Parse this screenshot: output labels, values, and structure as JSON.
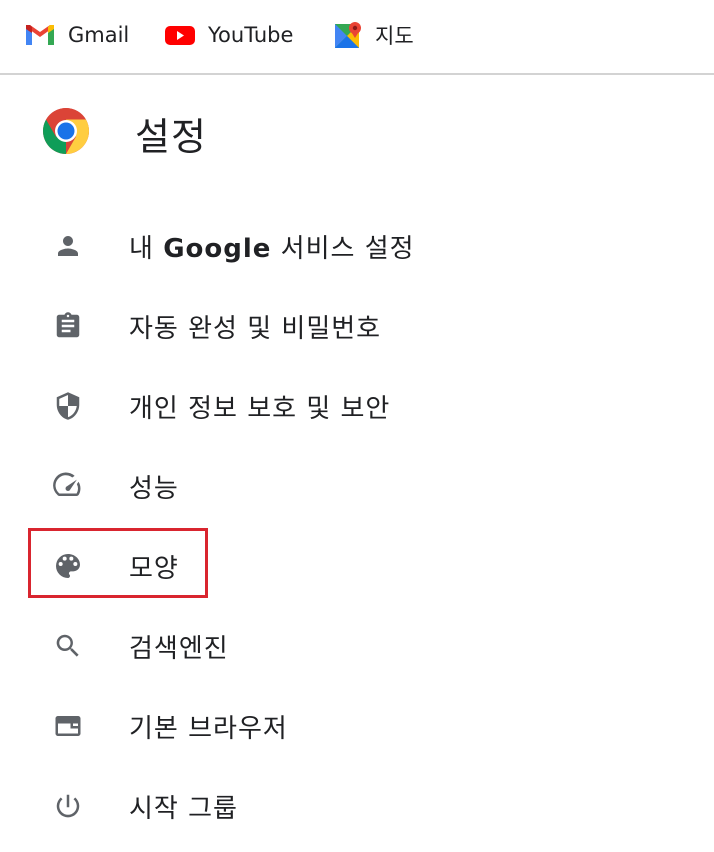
{
  "bookmarks": [
    {
      "label": "Gmail",
      "icon": "gmail-icon"
    },
    {
      "label": "YouTube",
      "icon": "youtube-icon"
    },
    {
      "label": "지도",
      "icon": "google-maps-icon"
    }
  ],
  "header": {
    "title": "설정",
    "logo_icon": "chrome-logo-icon"
  },
  "menu": {
    "items": [
      {
        "icon": "person-icon",
        "label_prefix": "내 ",
        "label_bold": "Google",
        "label_suffix": " 서비스 설정"
      },
      {
        "icon": "clipboard-icon",
        "label": "자동 완성 및 비밀번호"
      },
      {
        "icon": "shield-icon",
        "label": "개인 정보 보호 및 보안"
      },
      {
        "icon": "speedometer-icon",
        "label": "성능"
      },
      {
        "icon": "palette-icon",
        "label": "모양",
        "highlighted": true
      },
      {
        "icon": "search-icon",
        "label": "검색엔진"
      },
      {
        "icon": "browser-window-icon",
        "label": "기본 브라우저"
      },
      {
        "icon": "power-icon",
        "label": "시작 그룹"
      }
    ]
  },
  "colors": {
    "highlight": "#d9252f",
    "icon": "#5f6368",
    "divider": "#d3d3d3"
  }
}
